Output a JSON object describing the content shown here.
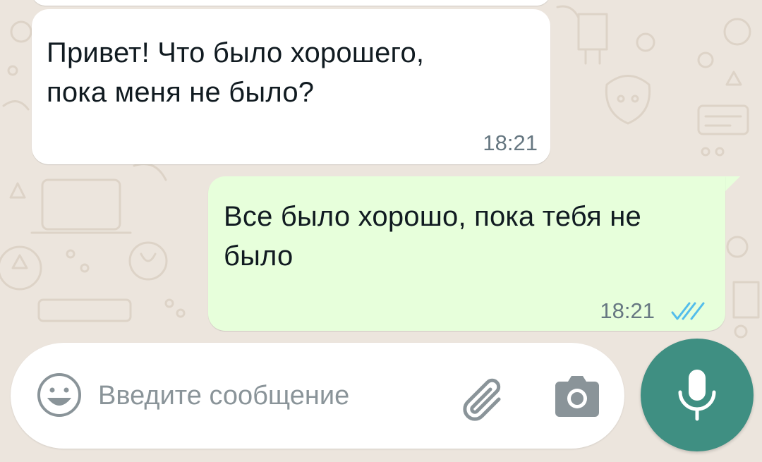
{
  "theme": {
    "wallpaper_color": "#ece5dd",
    "incoming_bubble_color": "#ffffff",
    "outgoing_bubble_color": "#e7ffdb",
    "read_ticks_color": "#53bdeb",
    "mic_button_color": "#3f8f82"
  },
  "messages": [
    {
      "direction": "incoming",
      "text": "Привет! Что было хорошего, пока меня не было?",
      "time": "18:21"
    },
    {
      "direction": "outgoing",
      "text": "Все было хорошо, пока тебя не было",
      "time": "18:21",
      "status_icon": "double-check-read-icon"
    }
  ],
  "composer": {
    "placeholder": "Введите сообщение",
    "value": "",
    "icons": {
      "emoji": "emoji-icon",
      "attach": "paperclip-icon",
      "camera": "camera-icon",
      "send": "microphone-icon"
    }
  }
}
